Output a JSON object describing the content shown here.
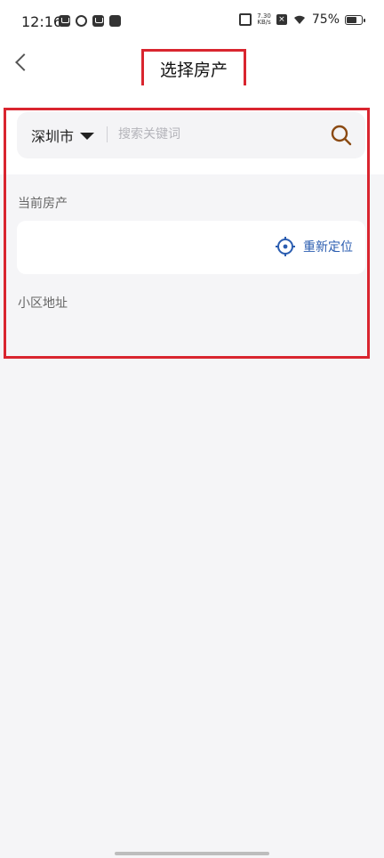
{
  "status_bar": {
    "time": "12:16",
    "speed_top": "7.30",
    "speed_unit": "KB/s",
    "battery_percent": "75%",
    "battery_level": 0.75
  },
  "nav": {
    "title": "选择房产"
  },
  "search": {
    "city": "深圳市",
    "placeholder": "搜索关键词",
    "value": ""
  },
  "sections": {
    "current_property_label": "当前房产",
    "relocate_label": "重新定位",
    "address_label": "小区地址"
  },
  "colors": {
    "accent": "#2b5db0",
    "search_icon": "#8b4a12",
    "highlight": "#d9252f"
  }
}
